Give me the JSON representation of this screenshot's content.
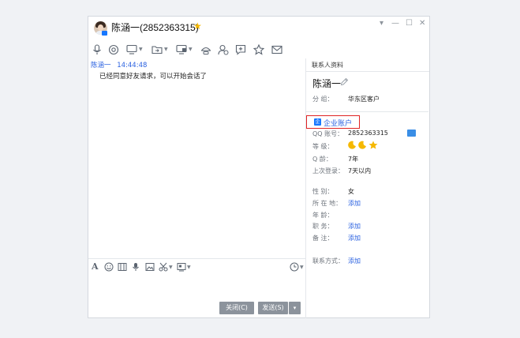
{
  "window": {
    "title": "陈涵一(2852363315)",
    "controls": {
      "settings": "▾",
      "minimize": "—",
      "maximize": "☐",
      "close": "✕"
    }
  },
  "toolbar": {
    "items": [
      "microphone-icon",
      "video-icon",
      "screen-share-icon",
      "folder-icon",
      "remote-desktop-icon",
      "meeting-icon",
      "add-contact-icon",
      "message-plus-icon",
      "favorite-icon",
      "email-icon"
    ]
  },
  "chat": {
    "messages": [
      {
        "sender": "陈涵一",
        "time": "14:44:48",
        "text": "已经同意好友请求，可以开始会话了"
      }
    ]
  },
  "input_toolbar": {
    "items": [
      "font-icon",
      "emoji-icon",
      "gif-icon",
      "voice-icon",
      "image-icon",
      "screenshot-icon",
      "more-icon"
    ],
    "history_icon": "clock-icon"
  },
  "buttons": {
    "close": "关闭(C)",
    "send": "发送(S)",
    "send_menu": "▾"
  },
  "profile": {
    "tab": "联系人资料",
    "name": "陈涵一",
    "group_label": "分    组：",
    "group_value": "华东区客户",
    "enterprise": "企业账户",
    "qq_label": "QQ  账号：",
    "qq_value": "2852363315",
    "level_label": "等    级：",
    "level_icons": [
      "moon",
      "moon",
      "star"
    ],
    "age_label": "Q     龄：",
    "age_value": "7年",
    "last_login_label": "上次登录：",
    "last_login_value": "7天以内",
    "gender_label": "性    别：",
    "gender_value": "女",
    "location_label": "所 在 地：",
    "location_value": "添加",
    "years_label": "年    龄：",
    "position_label": "职    务：",
    "position_value": "添加",
    "note_label": "备    注：",
    "note_value": "添加",
    "contact_label": "联系方式：",
    "contact_value": "添加"
  },
  "colors": {
    "accent": "#2a61e0",
    "highlight": "#e02424",
    "button": "#8c939c"
  }
}
